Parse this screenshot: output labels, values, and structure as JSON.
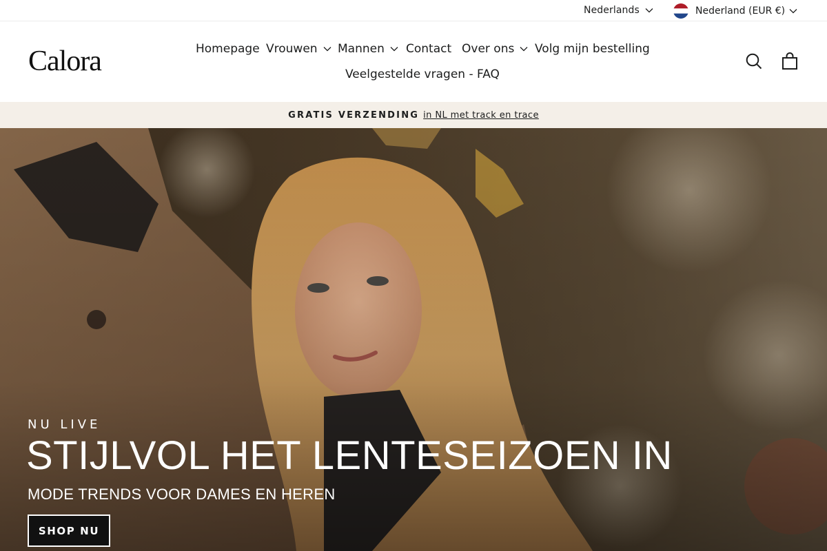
{
  "topbar": {
    "language": "Nederlands",
    "country": "Nederland (EUR €)"
  },
  "header": {
    "logo": "Calora",
    "nav": [
      {
        "label": "Homepage",
        "dropdown": false
      },
      {
        "label": "Vrouwen",
        "dropdown": true
      },
      {
        "label": "Mannen",
        "dropdown": true
      },
      {
        "label": "Contact",
        "dropdown": false
      },
      {
        "label": "Over ons",
        "dropdown": true
      },
      {
        "label": "Volg mijn bestelling",
        "dropdown": false
      },
      {
        "label": "Veelgestelde vragen - FAQ",
        "dropdown": false
      }
    ],
    "icons": [
      "search-icon",
      "cart-icon"
    ]
  },
  "announcement": {
    "strong": "GRATIS VERZENDING",
    "rest": "in NL met track en trace"
  },
  "hero": {
    "eyebrow": "NU LIVE",
    "title": "STIJLVOL HET LENTESEIZOEN IN",
    "subtitle": "MODE TRENDS VOOR DAMES EN HEREN",
    "button": "SHOP NU"
  },
  "colors": {
    "announcement_bg": "#f4efe8",
    "text": "#1c1d1d",
    "button_bg": "#111111"
  }
}
